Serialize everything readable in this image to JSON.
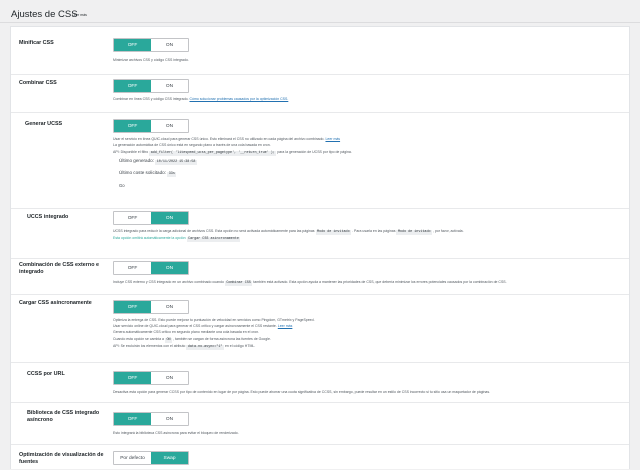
{
  "header": {
    "title": "Ajustes de CSS",
    "learn_more": "Leer más"
  },
  "toggle_labels": {
    "off": "OFF",
    "on": "ON"
  },
  "settings": {
    "minify": {
      "label": "Minificar CSS",
      "state": "off",
      "desc": "Minimizar archivos CSS y código CSS integrado."
    },
    "combine": {
      "label": "Combinar CSS",
      "state": "off",
      "desc": "Combinar en línea CSS y código CSS integrado.",
      "link": "Cómo solucionar problemas causados por la optimización CSS."
    },
    "ucss": {
      "label": "Generar UCSS",
      "state": "off",
      "desc1": "Usar el servicio en línea QUIC.cloud para generar CSS único. Esto eliminará el CSS no utilizado en cada página del archivo combinado.",
      "desc1_link": "Leer más",
      "desc2": "La generación automática de CSS único está en segundo plano a través de una cola basada en cron.",
      "desc3_pre": "API: Disponible el filtro",
      "desc3_code": "add_filter( 'litespeed_ucss_per_pagetype', '__return_true' );",
      "desc3_post": "para la generación de UCSS por tipo de página.",
      "last_generated_label": "Último generado:",
      "last_generated_value": "10/11/2022 15:38:58",
      "last_requested_label": "Último coste solicitado:",
      "last_requested_value": "33s",
      "extra": "Go"
    },
    "ucss_inline": {
      "label": "UCCS integrado",
      "state": "on",
      "desc1_pre": "UCSS integrado para reducir la carga adicional de archivos CSS. Esta opción no será activada automáticamente para las páginas",
      "desc1_code": "Modo de invitado",
      "desc1_mid": ". Para usarla en las páginas",
      "desc1_code2": "Modo de invitado",
      "desc1_post": ", por favor, actívala.",
      "desc2_pre": "Esta opción omitirá automáticamente la opción",
      "desc2_code": "Cargar CSS asíncronamente"
    },
    "combine_external": {
      "label": "Combinación de CSS externo e integrado",
      "state": "on",
      "desc_pre": "Incluye CSS externo y CSS integrado en un archivo combinado cuando",
      "desc_code": "Combinar CSS",
      "desc_post": "también está activado. Esta opción ayuda a mantener las prioridades de CSS, que debería minimizar los errores potenciales causados por la combinación de CSS."
    },
    "async": {
      "label": "Cargar CSS asíncronamente",
      "state": "off",
      "desc1": "Optimiza la entrega de CSS. Esto puede mejorar tu puntuación de velocidad en servicios como Pingdom, GTmetrix y PageSpeed.",
      "desc2": "Usar servicio online de QUIC.cloud para generar el CSS crítico y cargar asíncronamente el CSS restante.",
      "desc2_link": "Leer más",
      "desc3": "Genera automáticamente CSS crítico en segundo plano mediante una cola basada en el cron.",
      "desc4_pre": "Cuando esta opción se cambia a",
      "desc4_code": "ON",
      "desc4_post": ", también se cargan de forma asíncrona las fuentes de Google.",
      "desc5_pre": "API: Se excluirán los elementos con el atributo",
      "desc5_code": "data-no-async=\"1\"",
      "desc5_post": "en el código HTML."
    },
    "ccss_per_url": {
      "label": "CCSS por URL",
      "state": "off",
      "desc": "Desactiva esta opción para generar CCSS por tipo de contenido en lugar de por página. Esto puede ahorrar una cuota significativa de CCSS, sin embargo, puede resultar en un estilo de CSS incorrecto si tu sitio usa un maquetador de páginas."
    },
    "async_inline": {
      "label": "Biblioteca de CSS integrado asíncrono",
      "state": "off",
      "desc": "Esto integrará la biblioteca CSS asíncrona para evitar el bloqueo de renderizado."
    },
    "font_display": {
      "label": "Optimización de visualización de fuentes",
      "options": [
        "Por defecto",
        "Swap"
      ],
      "selected": "Swap"
    }
  }
}
